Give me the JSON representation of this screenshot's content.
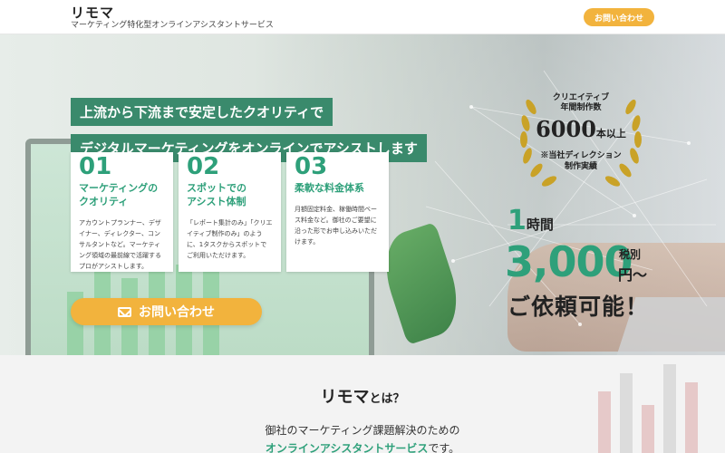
{
  "header": {
    "logo": "リモマ",
    "tagline": "マーケティング特化型オンラインアシスタントサービス",
    "contact_button": "お問い合わせ"
  },
  "hero": {
    "headline_1": "上流から下流まで安定したクオリティで",
    "headline_2": "デジタルマーケティングをオンラインでアシストします",
    "features": [
      {
        "number": "01",
        "title": "マーケティングの\nクオリティ",
        "description": "アカウントプランナー、デザイナー、ディレクター、コンサルタントなど。マーケティング領域の最前線で活躍するプロがアシストします。"
      },
      {
        "number": "02",
        "title": "スポットでの\nアシスト体制",
        "description": "「レポート集計のみ」「クリエイティブ制作のみ」のように、1タスクからスポットでご利用いただけます。"
      },
      {
        "number": "03",
        "title": "柔軟な料金体系",
        "description": "月額固定料金、稼働時間ベース料金など。御社のご要望に沿った形でお申し込みいただけます。"
      }
    ],
    "cta_button": "お問い合わせ"
  },
  "award": {
    "line1": "クリエイティブ",
    "line2": "年間制作数",
    "count": "6000",
    "count_suffix": "本以上",
    "note": "※当社ディレクション\n制作実績"
  },
  "price": {
    "hours": "1",
    "hours_unit": "時間",
    "amount": "3,000",
    "tax": "税別",
    "unit": "円〜",
    "cta": "ご依頼可能！"
  },
  "about": {
    "title_logo": "リモマ",
    "title_suffix": "とは？",
    "text_line1": "御社のマーケティング課題解決のための",
    "text_line2_highlight": "オンラインアシスタントサービス",
    "text_line2_suffix": "です。"
  },
  "colors": {
    "accent_green": "#2ea07a",
    "headline_bg": "#3a8a6c",
    "button_orange": "#f2b33d"
  }
}
